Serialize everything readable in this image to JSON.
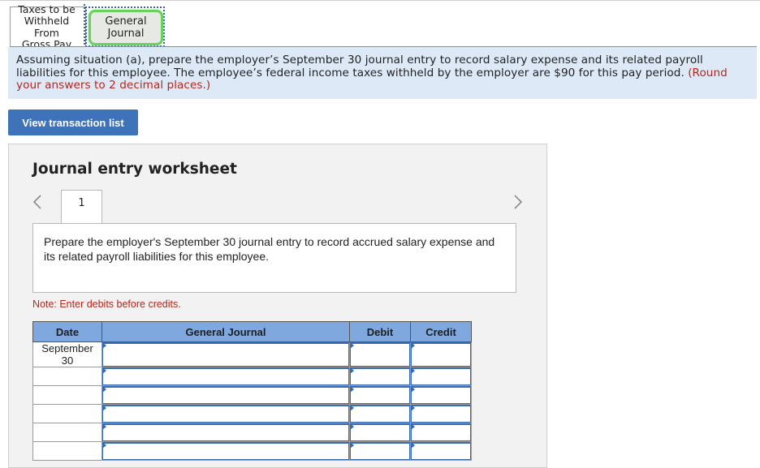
{
  "tabs": [
    {
      "label_lines": [
        "Taxes to be",
        "Withheld From",
        "Gross Pay"
      ],
      "active": false
    },
    {
      "label_lines": [
        "General",
        "Journal"
      ],
      "active": true
    }
  ],
  "instruction": {
    "text": "Assuming situation (a), prepare the employer’s September 30 journal entry to record salary expense and its related payroll liabilities for this employee. The employee’s federal income taxes withheld by the employer are $90 for this pay period.",
    "note_red": "(Round your answers to 2 decimal places.)"
  },
  "view_transaction_button": "View transaction list",
  "worksheet": {
    "title": "Journal entry worksheet",
    "current_page": "1",
    "prompt": "Prepare the employer's September 30 journal entry to record accrued salary expense and its related payroll liabilities for this employee.",
    "note": "Note: Enter debits before credits.",
    "table": {
      "headers": [
        "Date",
        "General Journal",
        "Debit",
        "Credit"
      ],
      "rows": [
        {
          "date_lines": [
            "September",
            "30"
          ],
          "account": "",
          "debit": "",
          "credit": ""
        },
        {
          "date_lines": [],
          "account": "",
          "debit": "",
          "credit": ""
        },
        {
          "date_lines": [],
          "account": "",
          "debit": "",
          "credit": ""
        },
        {
          "date_lines": [],
          "account": "",
          "debit": "",
          "credit": ""
        },
        {
          "date_lines": [],
          "account": "",
          "debit": "",
          "credit": ""
        },
        {
          "date_lines": [],
          "account": "",
          "debit": "",
          "credit": ""
        }
      ]
    }
  },
  "icons": {
    "prev": "chevron-left-icon",
    "next": "chevron-right-icon",
    "row_marker": "triangle-right-icon"
  },
  "colors": {
    "instruction_bg": "#dde9f7",
    "red_text": "#b5271b",
    "button_blue": "#3e73b9",
    "table_header": "#7fa8df",
    "active_tab_border": "#6ad25a",
    "focus_dotted": "#3a5fb4"
  }
}
